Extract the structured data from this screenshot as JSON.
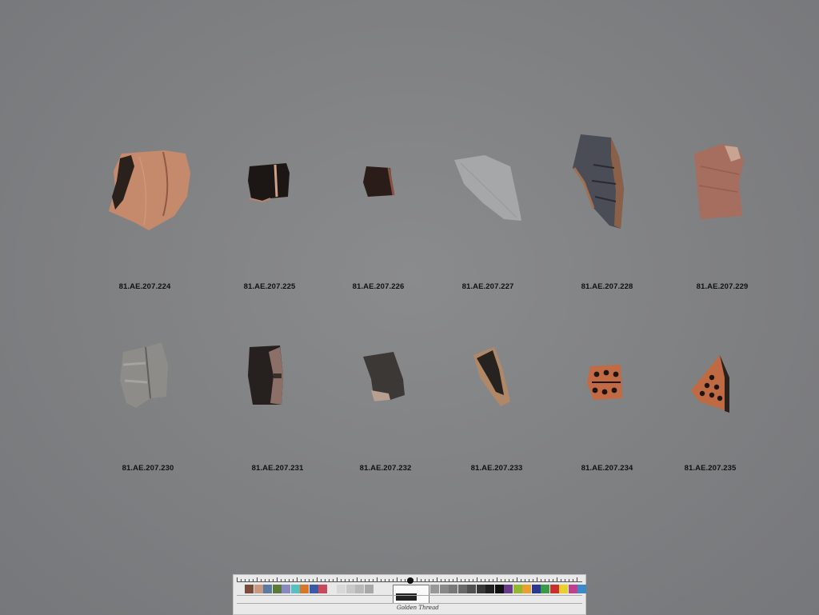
{
  "fragments": [
    {
      "label": "81.AE.207.224"
    },
    {
      "label": "81.AE.207.225"
    },
    {
      "label": "81.AE.207.226"
    },
    {
      "label": "81.AE.207.227"
    },
    {
      "label": "81.AE.207.228"
    },
    {
      "label": "81.AE.207.229"
    },
    {
      "label": "81.AE.207.230"
    },
    {
      "label": "81.AE.207.231"
    },
    {
      "label": "81.AE.207.232"
    },
    {
      "label": "81.AE.207.233"
    },
    {
      "label": "81.AE.207.234"
    },
    {
      "label": "81.AE.207.235"
    }
  ],
  "color_card": {
    "logo_text": "Golden Thread",
    "swatch_colors_left": [
      "#7a4a3a",
      "#c89a84",
      "#5c7aa0",
      "#5a7a3a",
      "#8a88c0",
      "#58c0c0",
      "#d8762a",
      "#3a5aa8",
      "#c84a5a",
      "#e8e8e8",
      "#d8d8d8",
      "#c8c8c8",
      "#b8b8b8",
      "#a8a8a8"
    ],
    "swatch_colors_right": [
      "#989898",
      "#888888",
      "#787878",
      "#686868",
      "#505050",
      "#383838",
      "#202020",
      "#101010",
      "#6a3a8a",
      "#90b830",
      "#e8a030",
      "#2a3a90",
      "#3a9a4a",
      "#c83030",
      "#e8d030",
      "#c04090",
      "#3a8ac8"
    ]
  }
}
